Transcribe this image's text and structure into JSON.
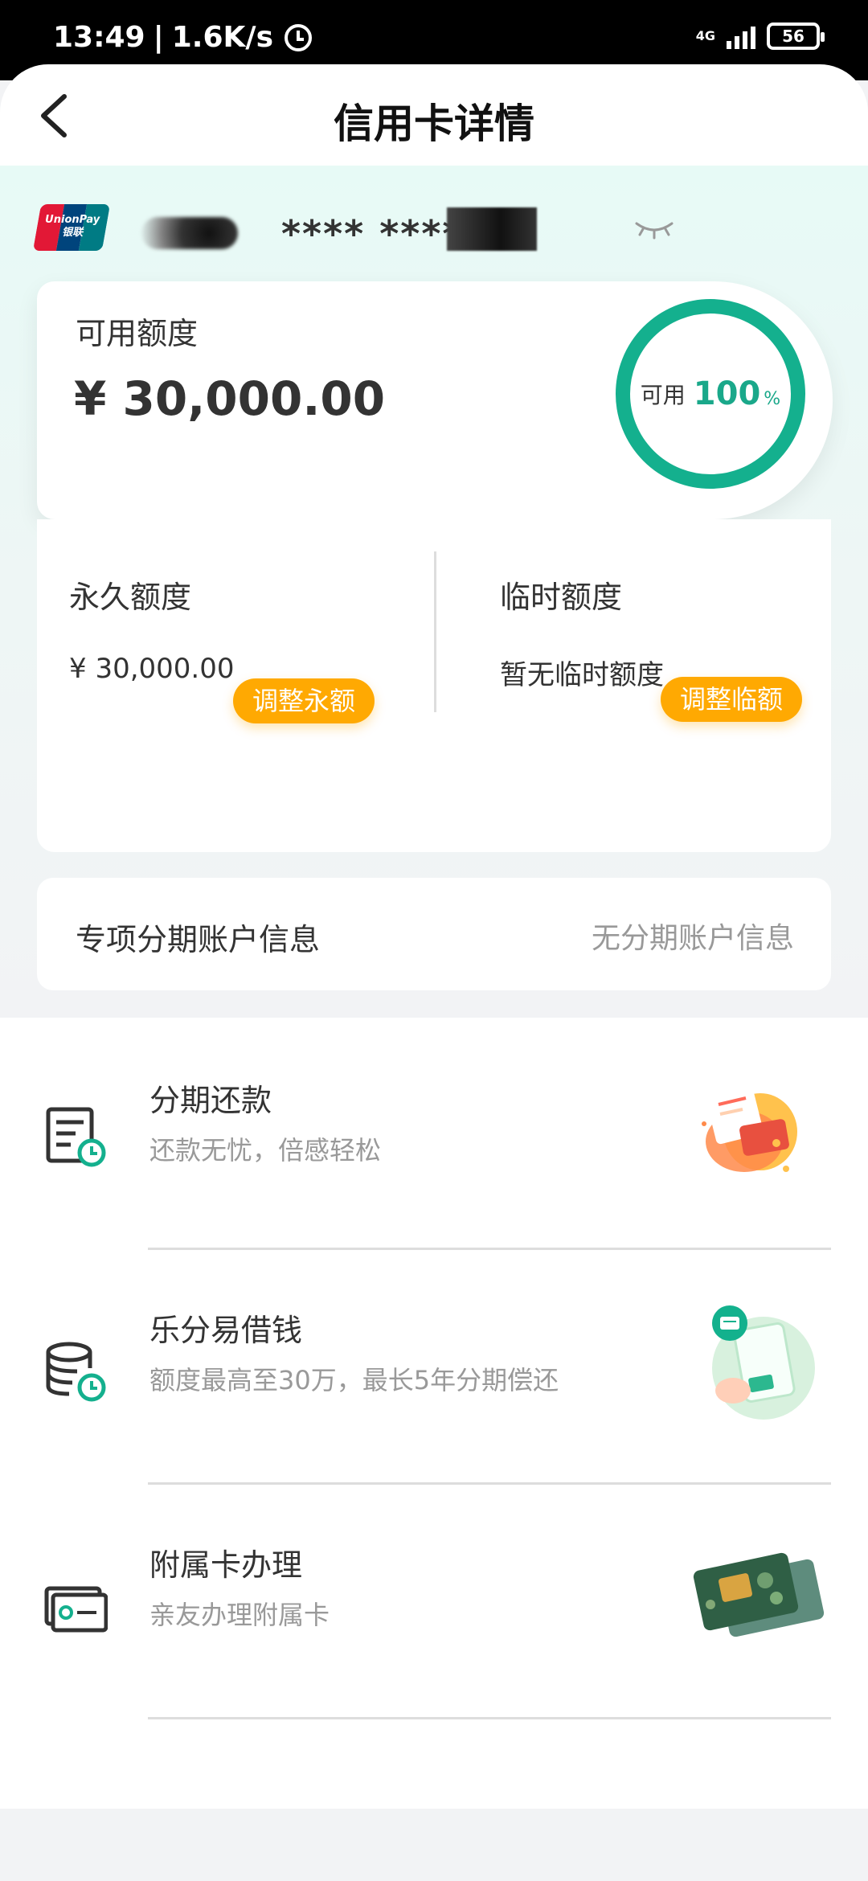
{
  "status_bar": {
    "time": "13:49",
    "speed": "1.6K/s",
    "network": "4G",
    "battery": "56"
  },
  "header": {
    "title": "信用卡详情"
  },
  "card": {
    "masked_number": "**** ****",
    "brand_en": "UnionPay",
    "brand_cn": "银联"
  },
  "available": {
    "label": "可用额度",
    "amount": "¥ 30,000.00",
    "ring_label": "可用",
    "ring_percent": "100",
    "ring_unit": "%",
    "ring_color": "#14b08e"
  },
  "permanent": {
    "title": "永久额度",
    "value": "¥ 30,000.00",
    "button": "调整永额"
  },
  "temporary": {
    "title": "临时额度",
    "value": "暂无临时额度",
    "button": "调整临额"
  },
  "installment_account": {
    "label": "专项分期账户信息",
    "value": "无分期账户信息"
  },
  "services": [
    {
      "title": "分期还款",
      "subtitle": "还款无忧，倍感轻松",
      "icon": "bill-clock-icon"
    },
    {
      "title": "乐分易借钱",
      "subtitle": "额度最高至30万，最长5年分期偿还",
      "icon": "coins-clock-icon"
    },
    {
      "title": "附属卡办理",
      "subtitle": "亲友办理附属卡",
      "icon": "card-icon"
    }
  ],
  "colors": {
    "accent": "#14b08e",
    "button": "#ffa902"
  }
}
